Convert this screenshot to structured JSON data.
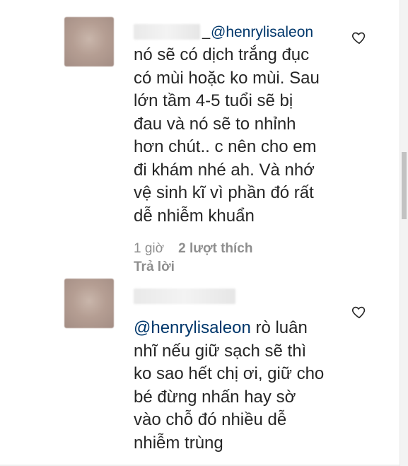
{
  "comments": [
    {
      "mention": "@henrylisaleon",
      "separator": "_",
      "lines": [
        "nó sẽ có dịch trắng đục",
        "có mùi hoặc ko mùi. Sau",
        "lớn tầm 4-5 tuổi sẽ bị",
        "đau và nó sẽ to nhỉnh",
        "hơn chút.. c nên cho em",
        "đi khám nhé ah. Và nhớ",
        "vệ sinh kĩ vì phần đó rất",
        "dễ nhiễm khuẩn"
      ],
      "time": "1 giờ",
      "likes": "2 lượt thích",
      "reply": "Trả lời",
      "like_icon": "heart-outline-icon"
    },
    {
      "mention": "@henrylisaleon",
      "first_line_rest": " rò luân",
      "lines": [
        "nhĩ nếu giữ sạch sẽ thì",
        "ko sao hết chị ơi, giữ cho",
        "bé đừng nhấn hay sờ",
        "vào chỗ đó nhiều dễ",
        "nhiễm trùng"
      ],
      "like_icon": "heart-outline-icon"
    }
  ],
  "colors": {
    "text": "#262626",
    "mention": "#00376b",
    "meta": "#8e8e8e"
  }
}
